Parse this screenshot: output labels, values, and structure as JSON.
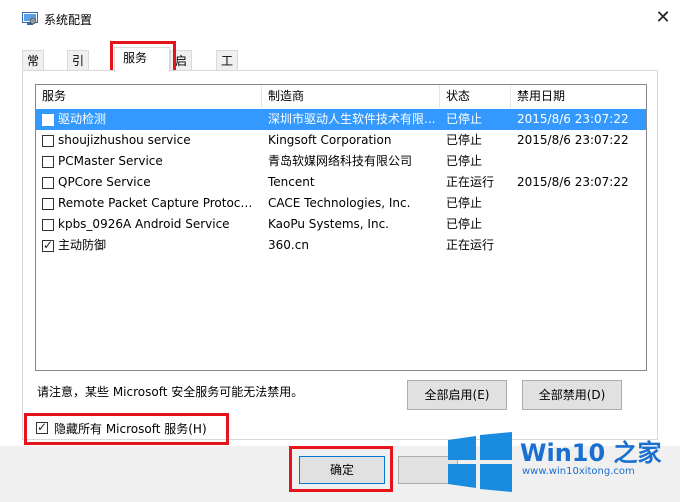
{
  "window": {
    "title": "系统配置",
    "close_glyph": "✕"
  },
  "tabs": [
    {
      "label": "常规"
    },
    {
      "label": "引导"
    },
    {
      "label": "服务"
    },
    {
      "label": "启动"
    },
    {
      "label": "工具"
    }
  ],
  "active_tab": "服务",
  "columns": [
    "服务",
    "制造商",
    "状态",
    "禁用日期"
  ],
  "rows": [
    {
      "checked": false,
      "service": "驱动检测",
      "maker": "深圳市驱动人生软件技术有限...",
      "status": "已停止",
      "date": "2015/8/6 23:07:22",
      "selected": true
    },
    {
      "checked": false,
      "service": "shoujizhushou service",
      "maker": "Kingsoft Corporation",
      "status": "已停止",
      "date": "2015/8/6 23:07:22"
    },
    {
      "checked": false,
      "service": "PCMaster Service",
      "maker": "青岛软媒网络科技有限公司",
      "status": "已停止",
      "date": ""
    },
    {
      "checked": false,
      "service": "QPCore Service",
      "maker": "Tencent",
      "status": "正在运行",
      "date": "2015/8/6 23:07:22"
    },
    {
      "checked": false,
      "service": "Remote Packet Capture Protocol...",
      "maker": "CACE Technologies, Inc.",
      "status": "已停止",
      "date": ""
    },
    {
      "checked": false,
      "service": "kpbs_0926A Android Service",
      "maker": "KaoPu Systems, Inc.",
      "status": "已停止",
      "date": ""
    },
    {
      "checked": true,
      "service": "主动防御",
      "maker": "360.cn",
      "status": "正在运行",
      "date": ""
    }
  ],
  "note": "请注意，某些 Microsoft 安全服务可能无法禁用。",
  "buttons": {
    "enable_all": "全部启用(E)",
    "disable_all": "全部禁用(D)",
    "ok": "确定"
  },
  "hide_ms": {
    "checked": true,
    "label": "隐藏所有 Microsoft 服务(H)"
  },
  "watermark": {
    "title": "Win10 之家",
    "url": "www.win10xitong.com"
  },
  "colors": {
    "selection": "#3399ff",
    "highlight_box": "#e5141c",
    "brand_blue": "#1a6fd1"
  }
}
